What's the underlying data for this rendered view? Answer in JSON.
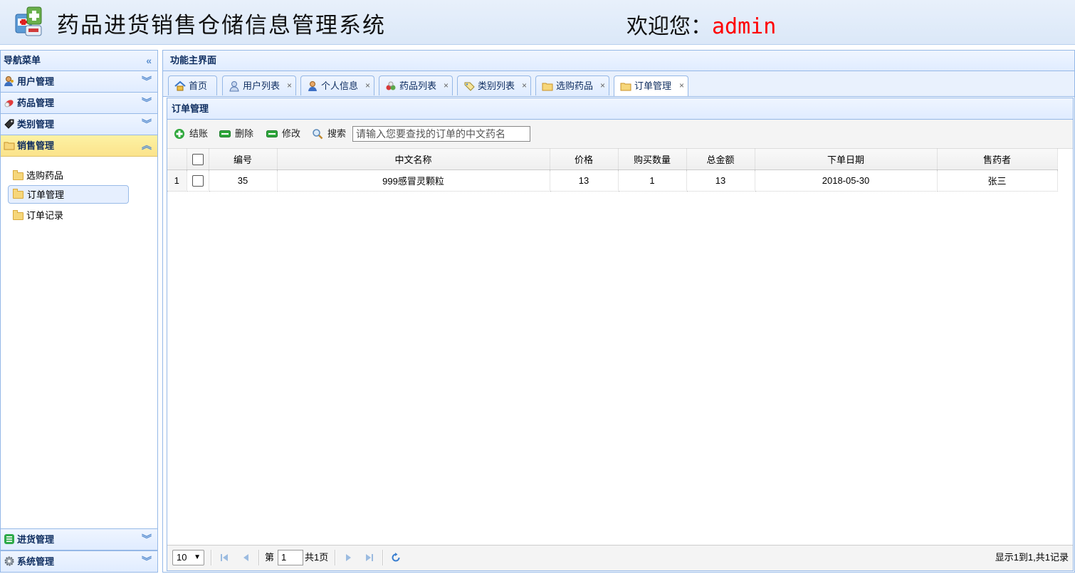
{
  "header": {
    "title": "药品进货销售仓储信息管理系统",
    "welcome_label": "欢迎您：",
    "username": "admin"
  },
  "nav": {
    "title": "导航菜单",
    "sections": [
      {
        "label": "用户管理",
        "icon": "user-icon"
      },
      {
        "label": "药品管理",
        "icon": "pill-icon"
      },
      {
        "label": "类别管理",
        "icon": "tag-icon"
      },
      {
        "label": "销售管理",
        "icon": "folder-icon",
        "active": true
      }
    ],
    "sales_items": [
      {
        "label": "选购药品"
      },
      {
        "label": "订单管理",
        "selected": true
      },
      {
        "label": "订单记录"
      }
    ],
    "bottom_sections": [
      {
        "label": "进货管理",
        "icon": "list-icon"
      },
      {
        "label": "系统管理",
        "icon": "gear-icon"
      }
    ]
  },
  "main": {
    "title": "功能主界面",
    "tabs": [
      {
        "label": "首页",
        "icon": "home-icon",
        "closable": false
      },
      {
        "label": "用户列表",
        "icon": "users-icon",
        "closable": true
      },
      {
        "label": "个人信息",
        "icon": "person-icon",
        "closable": true
      },
      {
        "label": "药品列表",
        "icon": "pills-icon",
        "closable": true
      },
      {
        "label": "类别列表",
        "icon": "tag-icon",
        "closable": true
      },
      {
        "label": "选购药品",
        "icon": "folder-icon",
        "closable": true
      },
      {
        "label": "订单管理",
        "icon": "folder-icon",
        "closable": true,
        "active": true
      }
    ],
    "close_glyph": "×"
  },
  "panel": {
    "title": "订单管理",
    "toolbar": {
      "checkout": "结账",
      "delete": "删除",
      "edit": "修改",
      "search": "搜索",
      "search_placeholder": "请输入您要查找的订单的中文药名"
    },
    "columns": [
      "编号",
      "中文名称",
      "价格",
      "购买数量",
      "总金额",
      "下单日期",
      "售药者"
    ],
    "rows": [
      {
        "rownum": "1",
        "id": "35",
        "name": "999感冒灵颗粒",
        "price": "13",
        "qty": "1",
        "total": "13",
        "date": "2018-05-30",
        "seller": "张三"
      }
    ],
    "pager": {
      "page_size": "10",
      "page_prefix": "第",
      "page_value": "1",
      "page_total": "共1页",
      "info": "显示1到1,共1记录"
    }
  },
  "colors": {
    "header_bg": "#dbe8f8",
    "border": "#95b8e7",
    "active_section": "#fbe38b",
    "username": "#ff0000"
  }
}
